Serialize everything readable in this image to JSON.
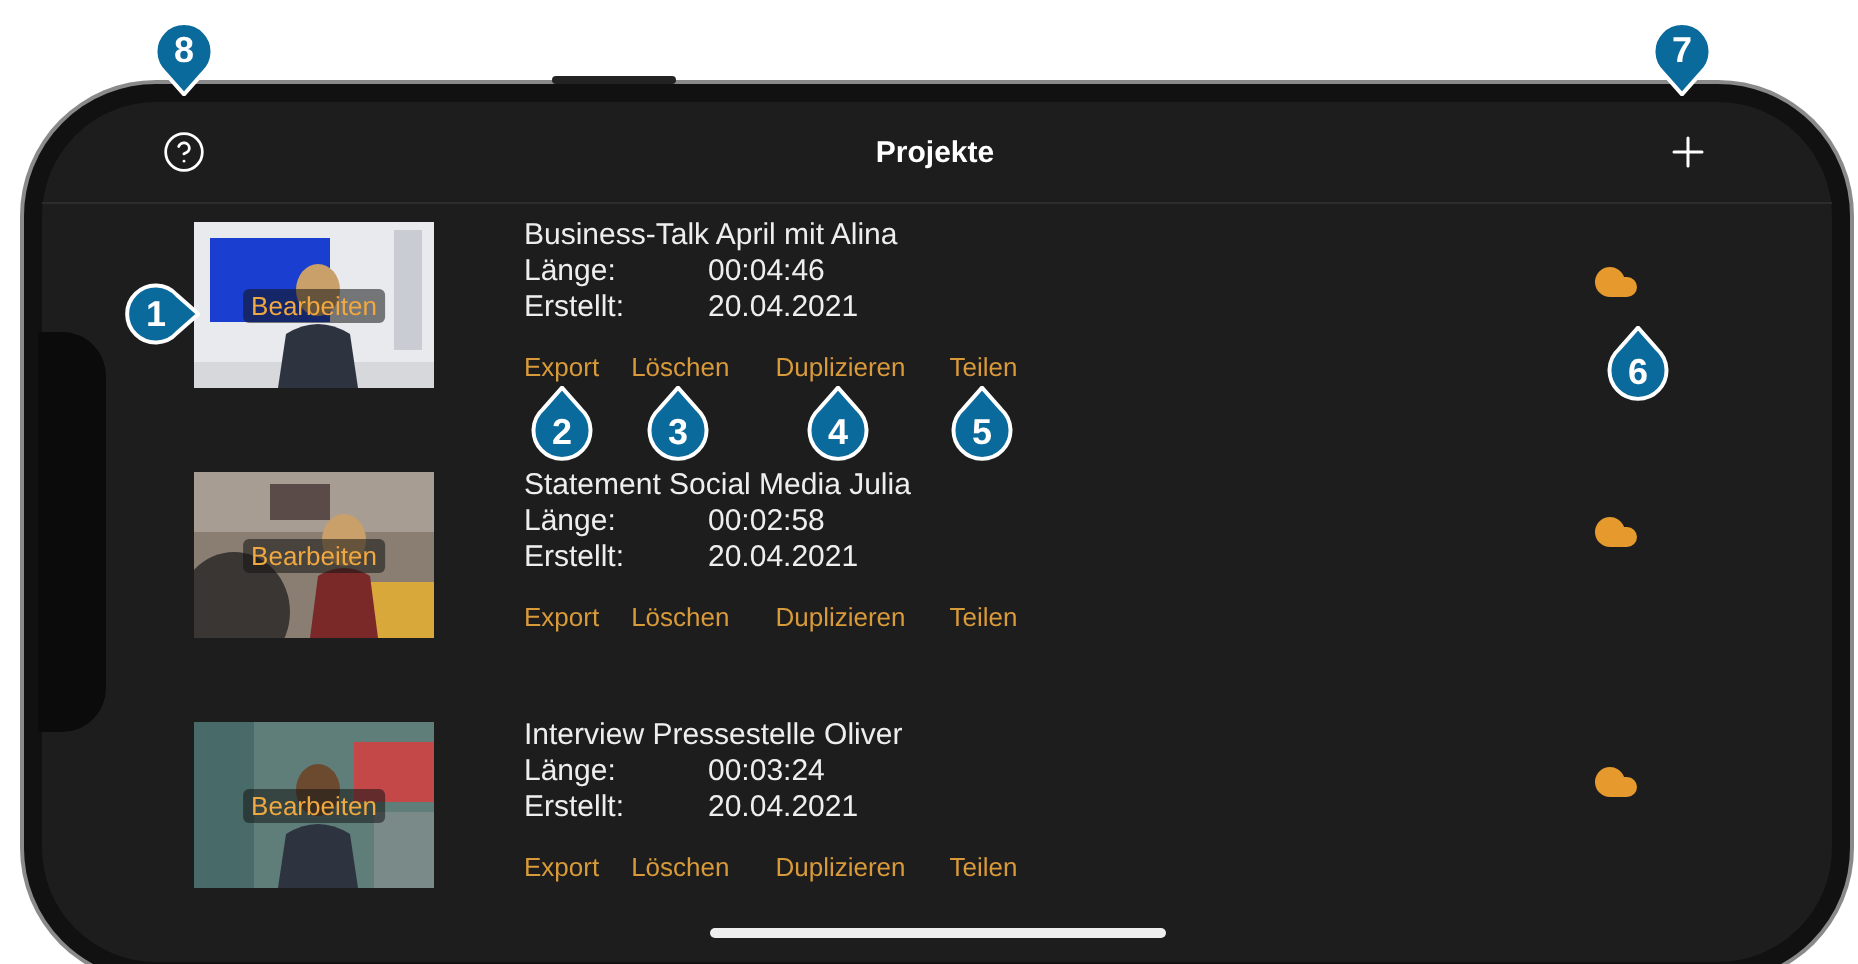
{
  "header": {
    "title": "Projekte"
  },
  "projects": [
    {
      "title": "Business-Talk April mit Alina",
      "edit_label": "Bearbeiten",
      "length_label": "Länge:",
      "length": "00:04:46",
      "created_label": "Erstellt:",
      "created": "20.04.2021",
      "actions": [
        "Export",
        "Löschen",
        "Duplizieren",
        "Teilen"
      ]
    },
    {
      "title": "Statement Social Media Julia",
      "edit_label": "Bearbeiten",
      "length_label": "Länge:",
      "length": "00:02:58",
      "created_label": "Erstellt:",
      "created": "20.04.2021",
      "actions": [
        "Export",
        "Löschen",
        "Duplizieren",
        "Teilen"
      ]
    },
    {
      "title": "Interview Pressestelle Oliver",
      "edit_label": "Bearbeiten",
      "length_label": "Länge:",
      "length": "00:03:24",
      "created_label": "Erstellt:",
      "created": "20.04.2021",
      "actions": [
        "Export",
        "Löschen",
        "Duplizieren",
        "Teilen"
      ]
    }
  ],
  "callouts": [
    "1",
    "2",
    "3",
    "4",
    "5",
    "6",
    "7",
    "8"
  ]
}
